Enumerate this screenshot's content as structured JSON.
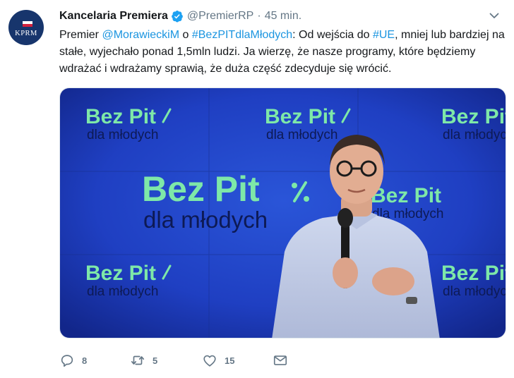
{
  "account": {
    "name": "Kancelaria Premiera",
    "handle": "@PremierRP",
    "separator": "·",
    "time": "45 min.",
    "avatar_text": "KPRM"
  },
  "tweet": {
    "t1": "Premier ",
    "mention": "@MorawieckiM",
    "t2": " o ",
    "hashtag1": "#BezPITdlaMłodych",
    "t3": ": Od wejścia do ",
    "hashtag2": "#UE",
    "t4": ", mniej lub bardziej na stałe, wyjechało ponad 1,5mln ludzi. Ja wierzę, że nasze programy, które będziemy wdrażać i wdrażamy sprawią, że duża część zdecyduje się wrócić."
  },
  "media": {
    "banner_title": "Bez Pit",
    "banner_sub": "dla młodych"
  },
  "actions": {
    "reply_count": "8",
    "retweet_count": "5",
    "like_count": "15"
  },
  "colors": {
    "link": "#1b95e0",
    "verified": "#1da1f2",
    "banner_green": "#7ee8a8",
    "banner_blue": "#1f3fc2"
  },
  "icons": [
    "verified-badge-icon",
    "chevron-down-icon",
    "reply-icon",
    "retweet-icon",
    "like-icon",
    "direct-message-icon"
  ]
}
